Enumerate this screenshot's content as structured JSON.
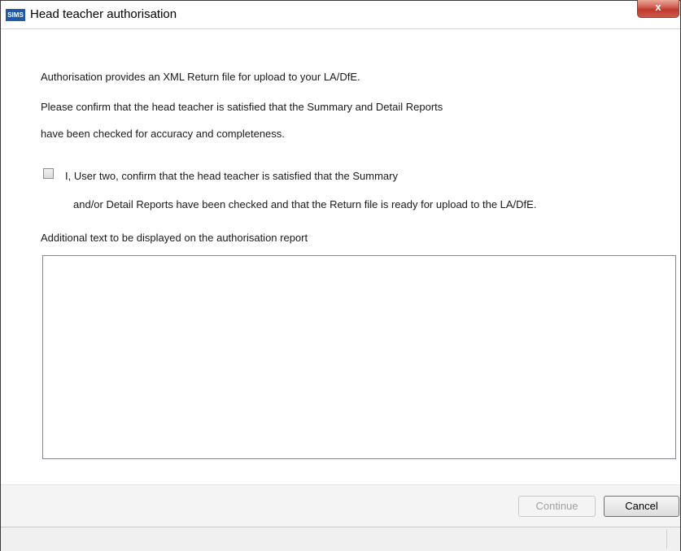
{
  "window": {
    "app_icon": "SIMS",
    "title": "Head teacher authorisation",
    "close_label": "x"
  },
  "content": {
    "intro": "Authorisation provides an XML Return file for upload to your LA/DfE.",
    "confirm_line1": "Please confirm that the head teacher is satisfied that the Summary and Detail Reports",
    "confirm_line2": "have been checked for accuracy and completeness.",
    "checkbox": {
      "checked": false,
      "label_line1": "I, User two, confirm that the head teacher is satisfied that the Summary",
      "label_line2": "and/or Detail Reports have been checked and that the Return file is ready for upload to the LA/DfE."
    },
    "additional_label": "Additional text to be displayed on the authorisation report",
    "additional_value": ""
  },
  "buttons": {
    "continue": "Continue",
    "cancel": "Cancel"
  },
  "colors": {
    "icon_blue": "#1f5aa6",
    "close_red": "#c0392b"
  }
}
